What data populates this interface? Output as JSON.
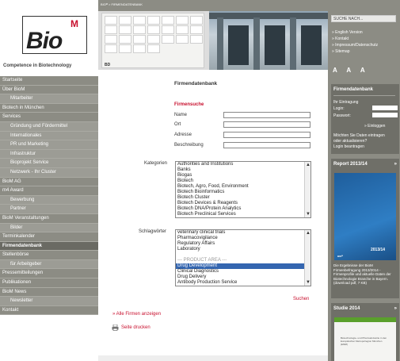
{
  "logo": {
    "text": "Bio",
    "superscript": "M",
    "tagline": "Competence in Biotechnology"
  },
  "breadcrumb": "BIOᴹ > FIRMENDATENBANK",
  "banner": {
    "logos": [
      "",
      "",
      "",
      "",
      "",
      "",
      "",
      "",
      "",
      "",
      "",
      "",
      "",
      "",
      "",
      "",
      "",
      "",
      "",
      "",
      "",
      "",
      "",
      "",
      ""
    ],
    "bd_label": "BD"
  },
  "nav": [
    {
      "label": "Startseite",
      "level": 0
    },
    {
      "label": "Über BioM",
      "level": 0
    },
    {
      "label": "Mitarbeiter",
      "level": 1
    },
    {
      "label": "Biotech in München",
      "level": 0
    },
    {
      "label": "Services",
      "level": 0
    },
    {
      "label": "Gründung und Fördermittel",
      "level": 1
    },
    {
      "label": "Internationales",
      "level": 1
    },
    {
      "label": "PR und Marketing",
      "level": 1
    },
    {
      "label": "Infrastruktur",
      "level": 1
    },
    {
      "label": "Bioprojekt Service",
      "level": 1
    },
    {
      "label": "Netzwerk - Ihr Cluster",
      "level": 1
    },
    {
      "label": "BioM AG",
      "level": 0
    },
    {
      "label": "m4 Award",
      "level": 0
    },
    {
      "label": "Bewerbung",
      "level": 1
    },
    {
      "label": "Partner",
      "level": 1
    },
    {
      "label": "BioM Veranstaltungen",
      "level": 0
    },
    {
      "label": "Bilder",
      "level": 1
    },
    {
      "label": "Terminkalender",
      "level": 0
    },
    {
      "label": "Firmendatenbank",
      "level": 0,
      "active": true
    },
    {
      "label": "Stellenbörse",
      "level": 0
    },
    {
      "label": "für Arbeitgeber",
      "level": 1
    },
    {
      "label": "Pressemitteilungen",
      "level": 0
    },
    {
      "label": "Publikationen",
      "level": 0
    },
    {
      "label": "BioM News",
      "level": 0
    },
    {
      "label": "Newsletter",
      "level": 1
    },
    {
      "label": "Kontakt",
      "level": 0
    }
  ],
  "main": {
    "title": "Firmendatenbank",
    "search_heading": "Firmensuche",
    "fields": [
      {
        "label": "Name",
        "value": ""
      },
      {
        "label": "Ort",
        "value": ""
      },
      {
        "label": "Adresse",
        "value": ""
      },
      {
        "label": "Beschreibung",
        "value": ""
      }
    ],
    "kategorien_label": "Kategorien",
    "kategorien": [
      "Authorities and Institutions",
      "Banks",
      "Biogas",
      "Biotech",
      "Biotech, Agro, Food, Environment",
      "Biotech Bioinformatics",
      "Biotech Cluster",
      "Biotech Devices & Reagents",
      "Biotech DNA/Protein Analytics",
      "Biotech Preclinical Services"
    ],
    "schlagwoerter_label": "Schlagwörter",
    "schlagwoerter": [
      {
        "label": "veterinary clinical trials"
      },
      {
        "label": "Pharmacovigilance"
      },
      {
        "label": "Regulatory Affairs"
      },
      {
        "label": "Laboratory"
      },
      {
        "label": ""
      },
      {
        "label": "--- PRODUCT AREA ---",
        "group": true
      },
      {
        "label": "Drug Development",
        "selected": true
      },
      {
        "label": "Clinical Diagnostics"
      },
      {
        "label": "Drug Delivery"
      },
      {
        "label": "Antibody Production Service"
      }
    ],
    "suchen": "Suchen",
    "alle_firmen": "» Alle Firmen anzeigen",
    "seite_drucken": "Seite drucken"
  },
  "right": {
    "search_placeholder": "SUCHE NACH...",
    "links": [
      "» English Version",
      "» Kontakt",
      "» Impressum/Datenschutz",
      "» Sitemap"
    ],
    "font_sizes": "A A A",
    "firmendatenbank": {
      "title": "Firmendatenbank",
      "ihr_eintrag": "Ihr Eintragung",
      "login_label": "Login:",
      "passwort_label": "Passwort:",
      "einloggen": "» Einloggen",
      "note_1": "Möchten Sie Daten eintragen",
      "note_2": "oder aktualisieren?",
      "note_3": "Login beantragen"
    },
    "report": {
      "title": "Report 2013/14",
      "arrow": "»",
      "img_label": "2013/14",
      "img_tag": "BIOᴹ",
      "desc": "Die Ergebnisse der BioM Firmenbefragung 2013/2014 - Firmenprofile und aktuelle Daten der Biotechnologie Branche in Bayern. (download pdf, 7 KB)"
    },
    "studie": {
      "title": "Studie 2014",
      "arrow": "»",
      "text": "Biotechnologie- und Pharmaindustrie in den Europäischen Metropolregion München (EMM)"
    }
  }
}
